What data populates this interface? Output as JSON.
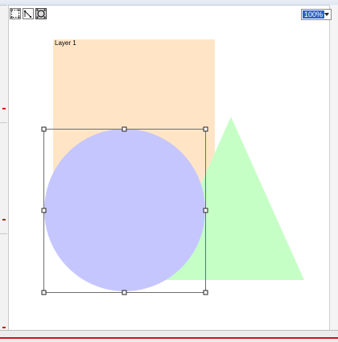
{
  "toolbar": {
    "tools": [
      {
        "icon": "rectangle-select-icon"
      },
      {
        "icon": "lasso-select-icon"
      },
      {
        "icon": "ellipse-select-icon",
        "active": true
      }
    ]
  },
  "zoom": {
    "value": "100%"
  },
  "layer": {
    "label": "Layer 1"
  },
  "shapes": {
    "rectangle_color": "#ffe5c6",
    "circle_color": "#c6c6ff",
    "triangle_color": "#c6ffc6"
  },
  "selection": {
    "handle_count": 8
  },
  "status": {
    "text": ""
  }
}
